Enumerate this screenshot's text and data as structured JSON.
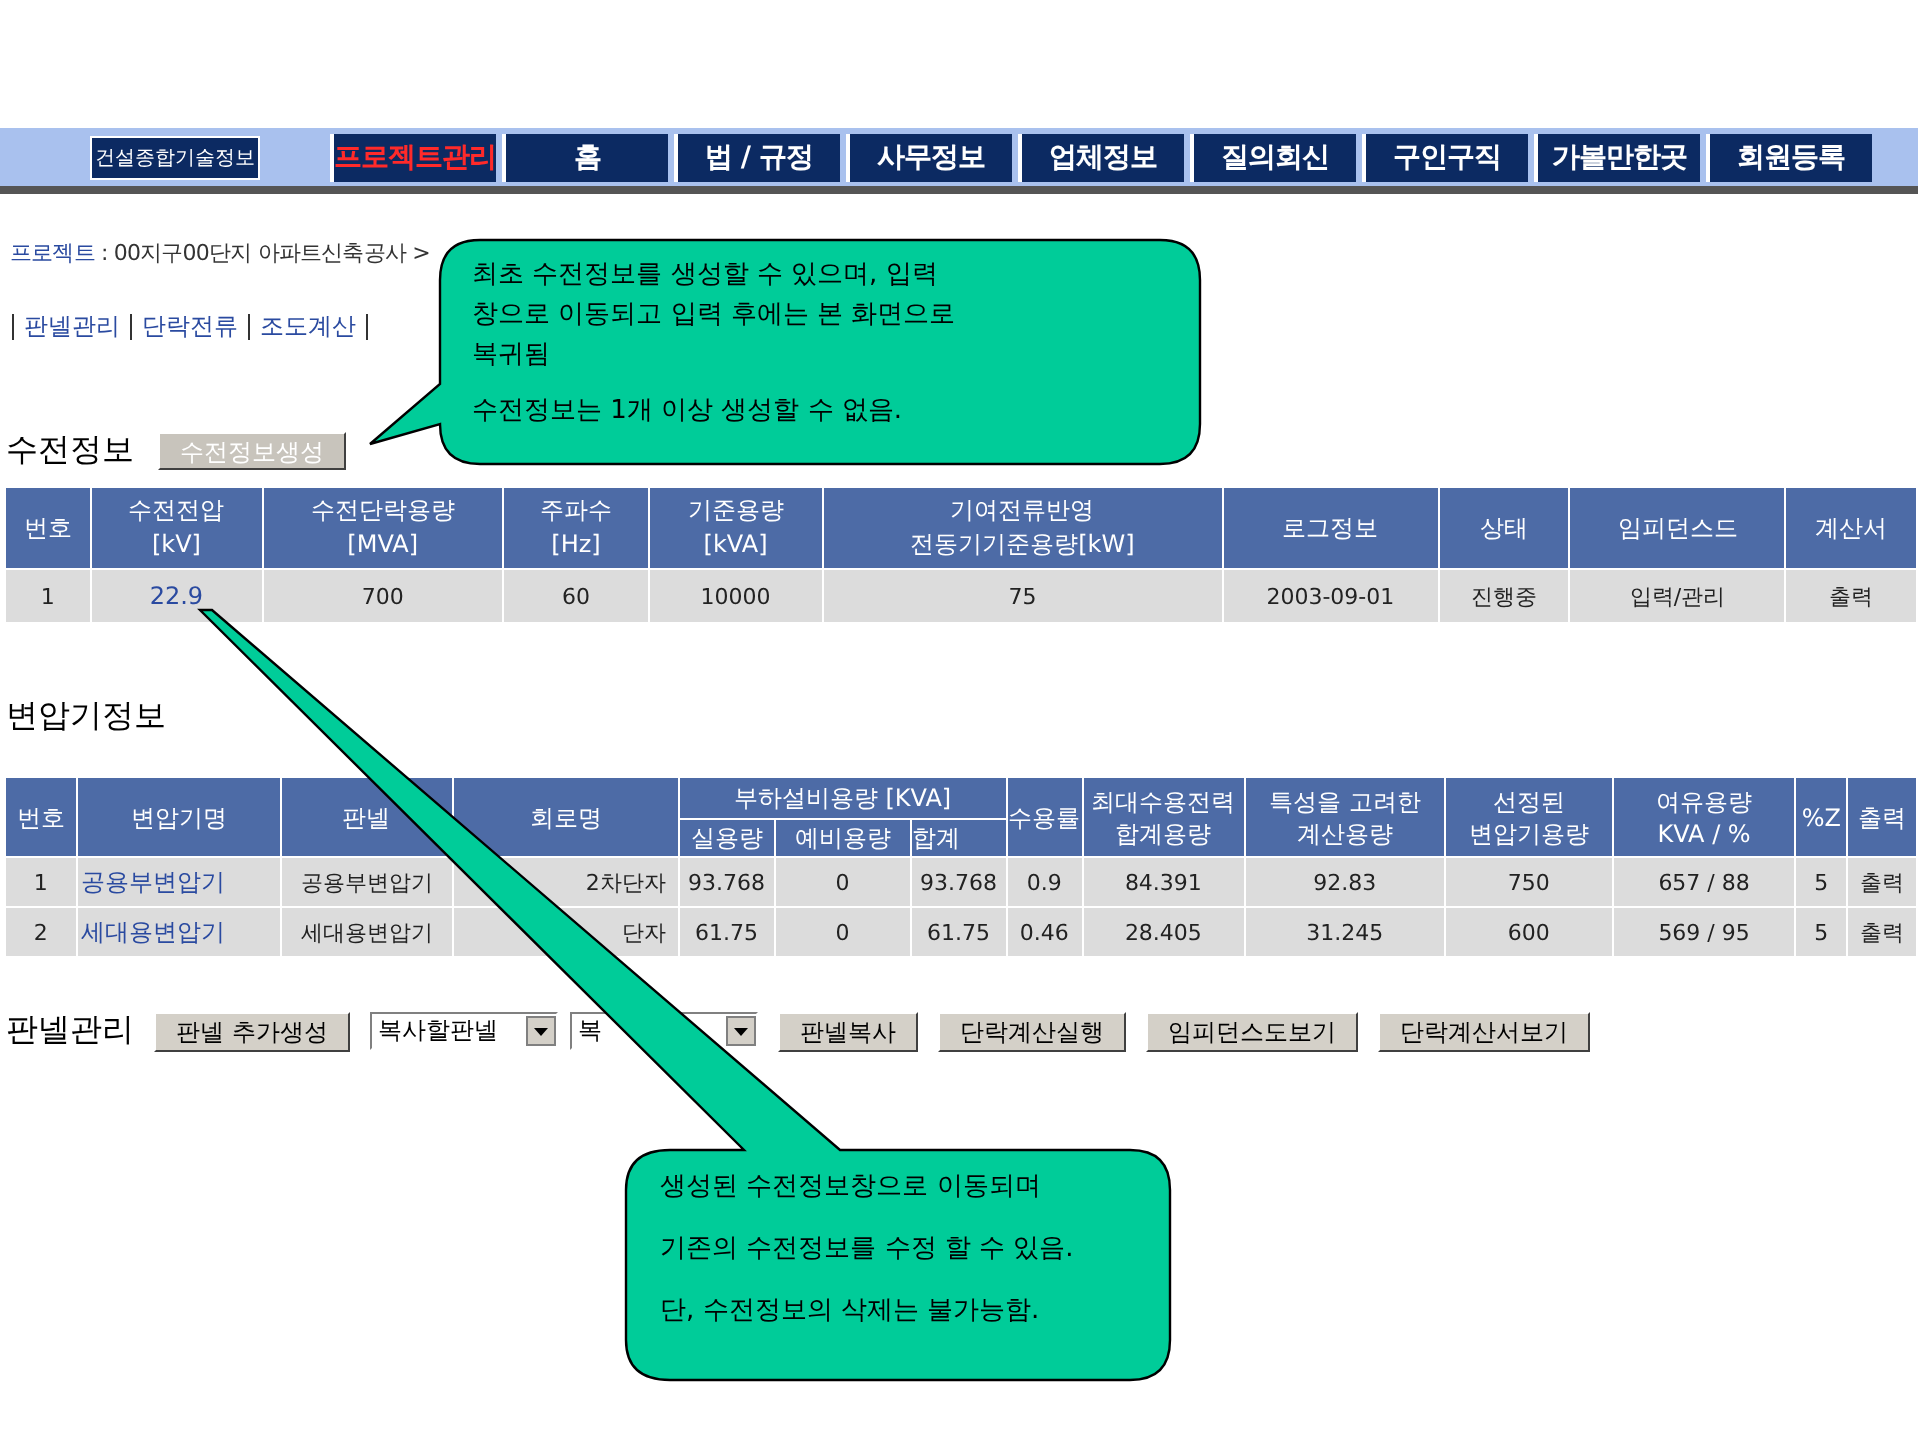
{
  "nav": {
    "logo": "건설종합기술정보",
    "items": [
      {
        "label": "프로젝트관리",
        "selected": true
      },
      {
        "label": "홈",
        "selected": false
      },
      {
        "label": "법 / 규정",
        "selected": false
      },
      {
        "label": "사무정보",
        "selected": false
      },
      {
        "label": "업체정보",
        "selected": false
      },
      {
        "label": "질의회신",
        "selected": false
      },
      {
        "label": "구인구직",
        "selected": false
      },
      {
        "label": "가볼만한곳",
        "selected": false
      },
      {
        "label": "회원등록",
        "selected": false
      }
    ]
  },
  "breadcrumb": {
    "label": "프로젝트",
    "text": " : 00지구00단지 아파트신축공사 >"
  },
  "sub_links": [
    "판넬관리",
    "단락전류",
    "조도계산"
  ],
  "power_section": {
    "title": "수전정보",
    "button": "수전정보생성",
    "table": {
      "columns": [
        "번호",
        "수전전압\n[kV]",
        "수전단락용량\n[MVA]",
        "주파수\n[Hz]",
        "기준용량\n[kVA]",
        "기여전류반영\n전동기기준용량[kW]",
        "로그정보",
        "상태",
        "임피던스드",
        "계산서"
      ],
      "rows": [
        [
          {
            "text": "1"
          },
          {
            "text": "22.9",
            "kind": "link"
          },
          {
            "text": "700"
          },
          {
            "text": "60"
          },
          {
            "text": "10000"
          },
          {
            "text": "75"
          },
          {
            "text": "2003-09-01"
          },
          {
            "text": "진행중"
          },
          {
            "text": "입력/관리"
          },
          {
            "text": "출력"
          }
        ]
      ]
    }
  },
  "transformer_section": {
    "title": "변압기정보",
    "table": {
      "columns": [
        {
          "label": "번호"
        },
        {
          "label": "변압기명"
        },
        {
          "label": "판넬"
        },
        {
          "label": "회로명"
        },
        {
          "label": "부하설비용량 [KVA]",
          "colspan": 3,
          "children": [
            "실용량",
            "예비용량",
            "합계"
          ]
        },
        {
          "label": "수용률"
        },
        {
          "label": "최대수용전력\n합계용량"
        },
        {
          "label": "특성을 고려한\n계산용량"
        },
        {
          "label": "선정된\n변압기용량"
        },
        {
          "label": "여유용량\nKVA / %"
        },
        {
          "label": "%Z"
        },
        {
          "label": "출력"
        }
      ],
      "rows": [
        [
          {
            "text": "1"
          },
          {
            "text": "공용부변압기",
            "kind": "link"
          },
          {
            "text": "공용부변압기"
          },
          {
            "text": "2차단자"
          },
          {
            "text": "93.768"
          },
          {
            "text": "0"
          },
          {
            "text": "93.768"
          },
          {
            "text": "0.9"
          },
          {
            "text": "84.391"
          },
          {
            "text": "92.83"
          },
          {
            "text": "750"
          },
          {
            "text": "657 / 88"
          },
          {
            "text": "5"
          },
          {
            "text": "출력"
          }
        ],
        [
          {
            "text": "2"
          },
          {
            "text": "세대용변압기",
            "kind": "link"
          },
          {
            "text": "세대용변압기"
          },
          {
            "text": "단자"
          },
          {
            "text": "61.75"
          },
          {
            "text": "0"
          },
          {
            "text": "61.75"
          },
          {
            "text": "0.46"
          },
          {
            "text": "28.405"
          },
          {
            "text": "31.245"
          },
          {
            "text": "600"
          },
          {
            "text": "569 / 95"
          },
          {
            "text": "5"
          },
          {
            "text": "출력"
          }
        ]
      ]
    }
  },
  "panel_section": {
    "title": "판넬관리",
    "controls": [
      {
        "kind": "button",
        "label": "판넬 추가생성"
      },
      {
        "kind": "select",
        "value": "복사할판넬"
      },
      {
        "kind": "select",
        "value": "복"
      },
      {
        "kind": "button",
        "label": "판넬복사"
      },
      {
        "kind": "button",
        "label": "단락계산실행"
      },
      {
        "kind": "button",
        "label": "임피던스도보기"
      },
      {
        "kind": "button",
        "label": "단락계산서보기"
      }
    ]
  },
  "callouts": [
    {
      "paragraphs": [
        [
          "최초 수전정보를 생성할 수 있으며, 입력",
          "창으로 이동되고 입력 후에는 본 화면으로",
          "복귀됨"
        ],
        [
          "수전정보는 1개 이상 생성할 수 없음."
        ]
      ]
    },
    {
      "paragraphs": [
        [
          "생성된 수전정보창으로 이동되며"
        ],
        [
          "기존의 수전정보를 수정 할 수 있음."
        ],
        [
          "단, 수전정보의 삭제는 불가능함."
        ]
      ]
    }
  ]
}
